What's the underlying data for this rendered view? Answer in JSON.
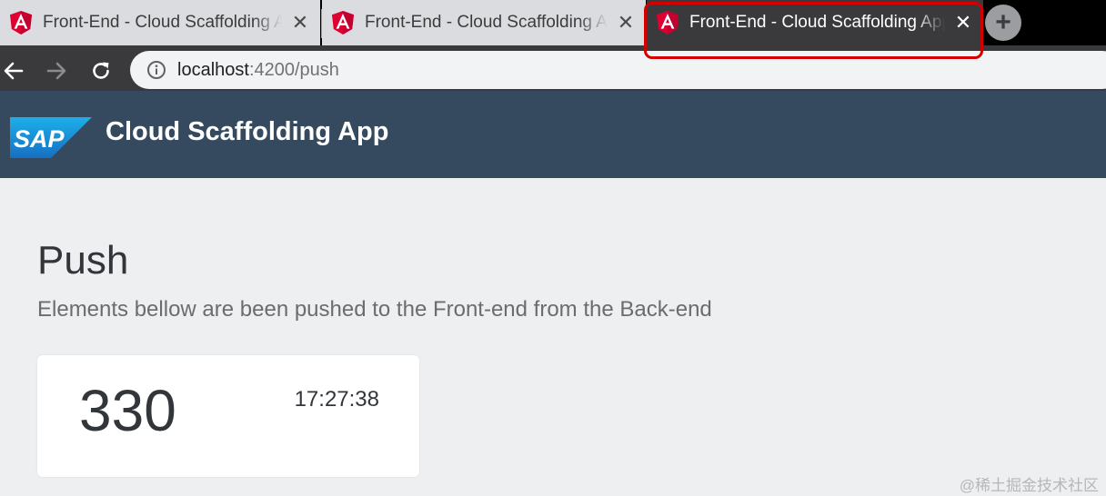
{
  "browser": {
    "tabs": [
      {
        "title": "Front-End - Cloud Scaffolding App",
        "active": false
      },
      {
        "title": "Front-End - Cloud Scaffolding App",
        "active": false
      },
      {
        "title": "Front-End - Cloud Scaffolding App",
        "active": true
      }
    ],
    "close_glyph": "✕",
    "new_tab_glyph": "+",
    "address": {
      "host": "localhost",
      "path": ":4200/push"
    },
    "icons": [
      "angular-icon",
      "close-icon",
      "new-tab-icon",
      "back-icon",
      "forward-icon",
      "reload-icon",
      "info-icon"
    ],
    "colors": {
      "highlight": "#d40000",
      "active_tab": "#3a3a3c",
      "inactive_tab": "#dadcdf"
    }
  },
  "shell": {
    "logo_text": "SAP",
    "app_title": "Cloud Scaffolding App",
    "color": "#354a5f"
  },
  "page": {
    "title": "Push",
    "subtitle": "Elements bellow are been pushed to the Front-end from the Back-end",
    "card": {
      "value": "330",
      "time": "17:27:38"
    }
  },
  "watermark": "@稀土掘金技术社区"
}
